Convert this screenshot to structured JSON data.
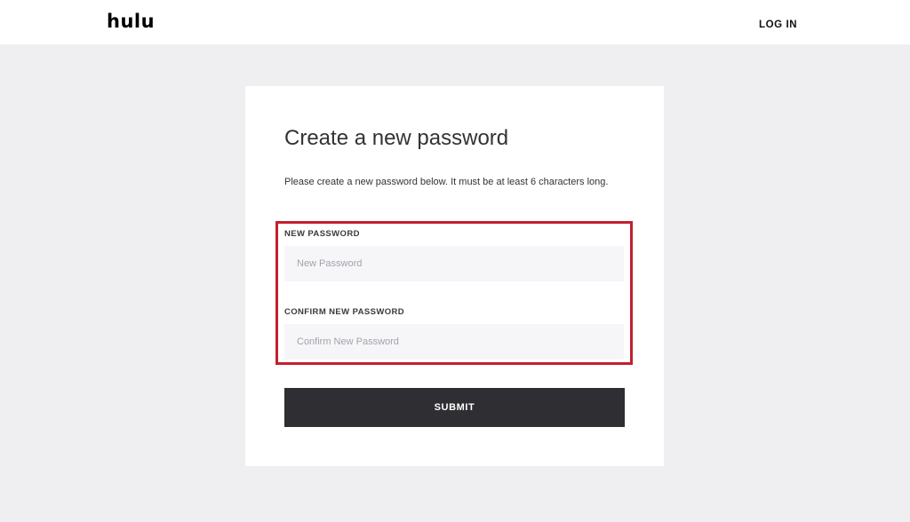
{
  "header": {
    "logo_text": "hulu",
    "login_label": "LOG IN"
  },
  "form": {
    "title": "Create a new password",
    "description": "Please create a new password below. It must be at least 6 characters long.",
    "new_password": {
      "label": "NEW PASSWORD",
      "placeholder": "New Password",
      "value": ""
    },
    "confirm_password": {
      "label": "CONFIRM NEW PASSWORD",
      "placeholder": "Confirm New Password",
      "value": ""
    },
    "submit_label": "SUBMIT"
  },
  "colors": {
    "page_background": "#efeff1",
    "highlight_border": "#c41f2e",
    "submit_background": "#2f2f33"
  }
}
